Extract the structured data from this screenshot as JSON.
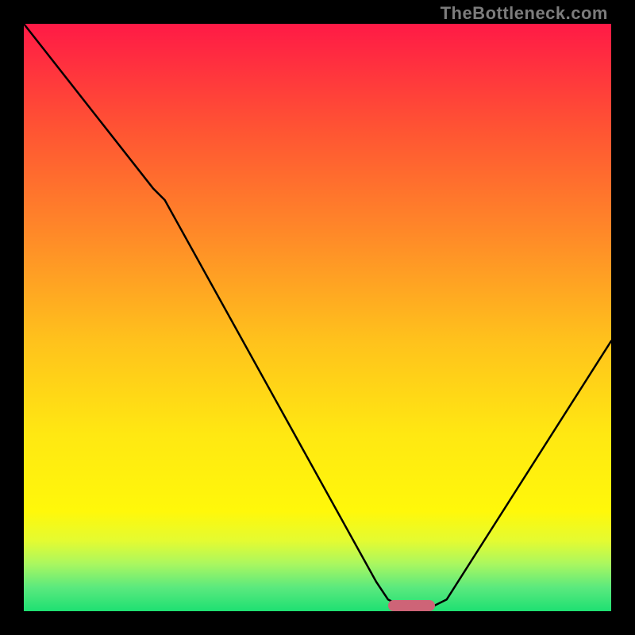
{
  "watermark": "TheBottleneck.com",
  "chart_data": {
    "type": "line",
    "title": "",
    "xlabel": "",
    "ylabel": "",
    "xlim": [
      0,
      100
    ],
    "ylim": [
      0,
      100
    ],
    "grid": false,
    "legend": false,
    "series": [
      {
        "name": "curve",
        "x": [
          0,
          22,
          24,
          60,
          62,
          66,
          68,
          72,
          100
        ],
        "values": [
          100,
          72,
          70,
          5,
          2,
          0,
          0,
          2,
          46
        ]
      }
    ],
    "marker": {
      "x_start": 62,
      "x_end": 70,
      "y": 0,
      "color": "#ce6477"
    },
    "colors": {
      "curve": "#000000",
      "gradient_top": "#ff1a46",
      "gradient_bottom": "#1ee072",
      "background": "#000000"
    }
  }
}
